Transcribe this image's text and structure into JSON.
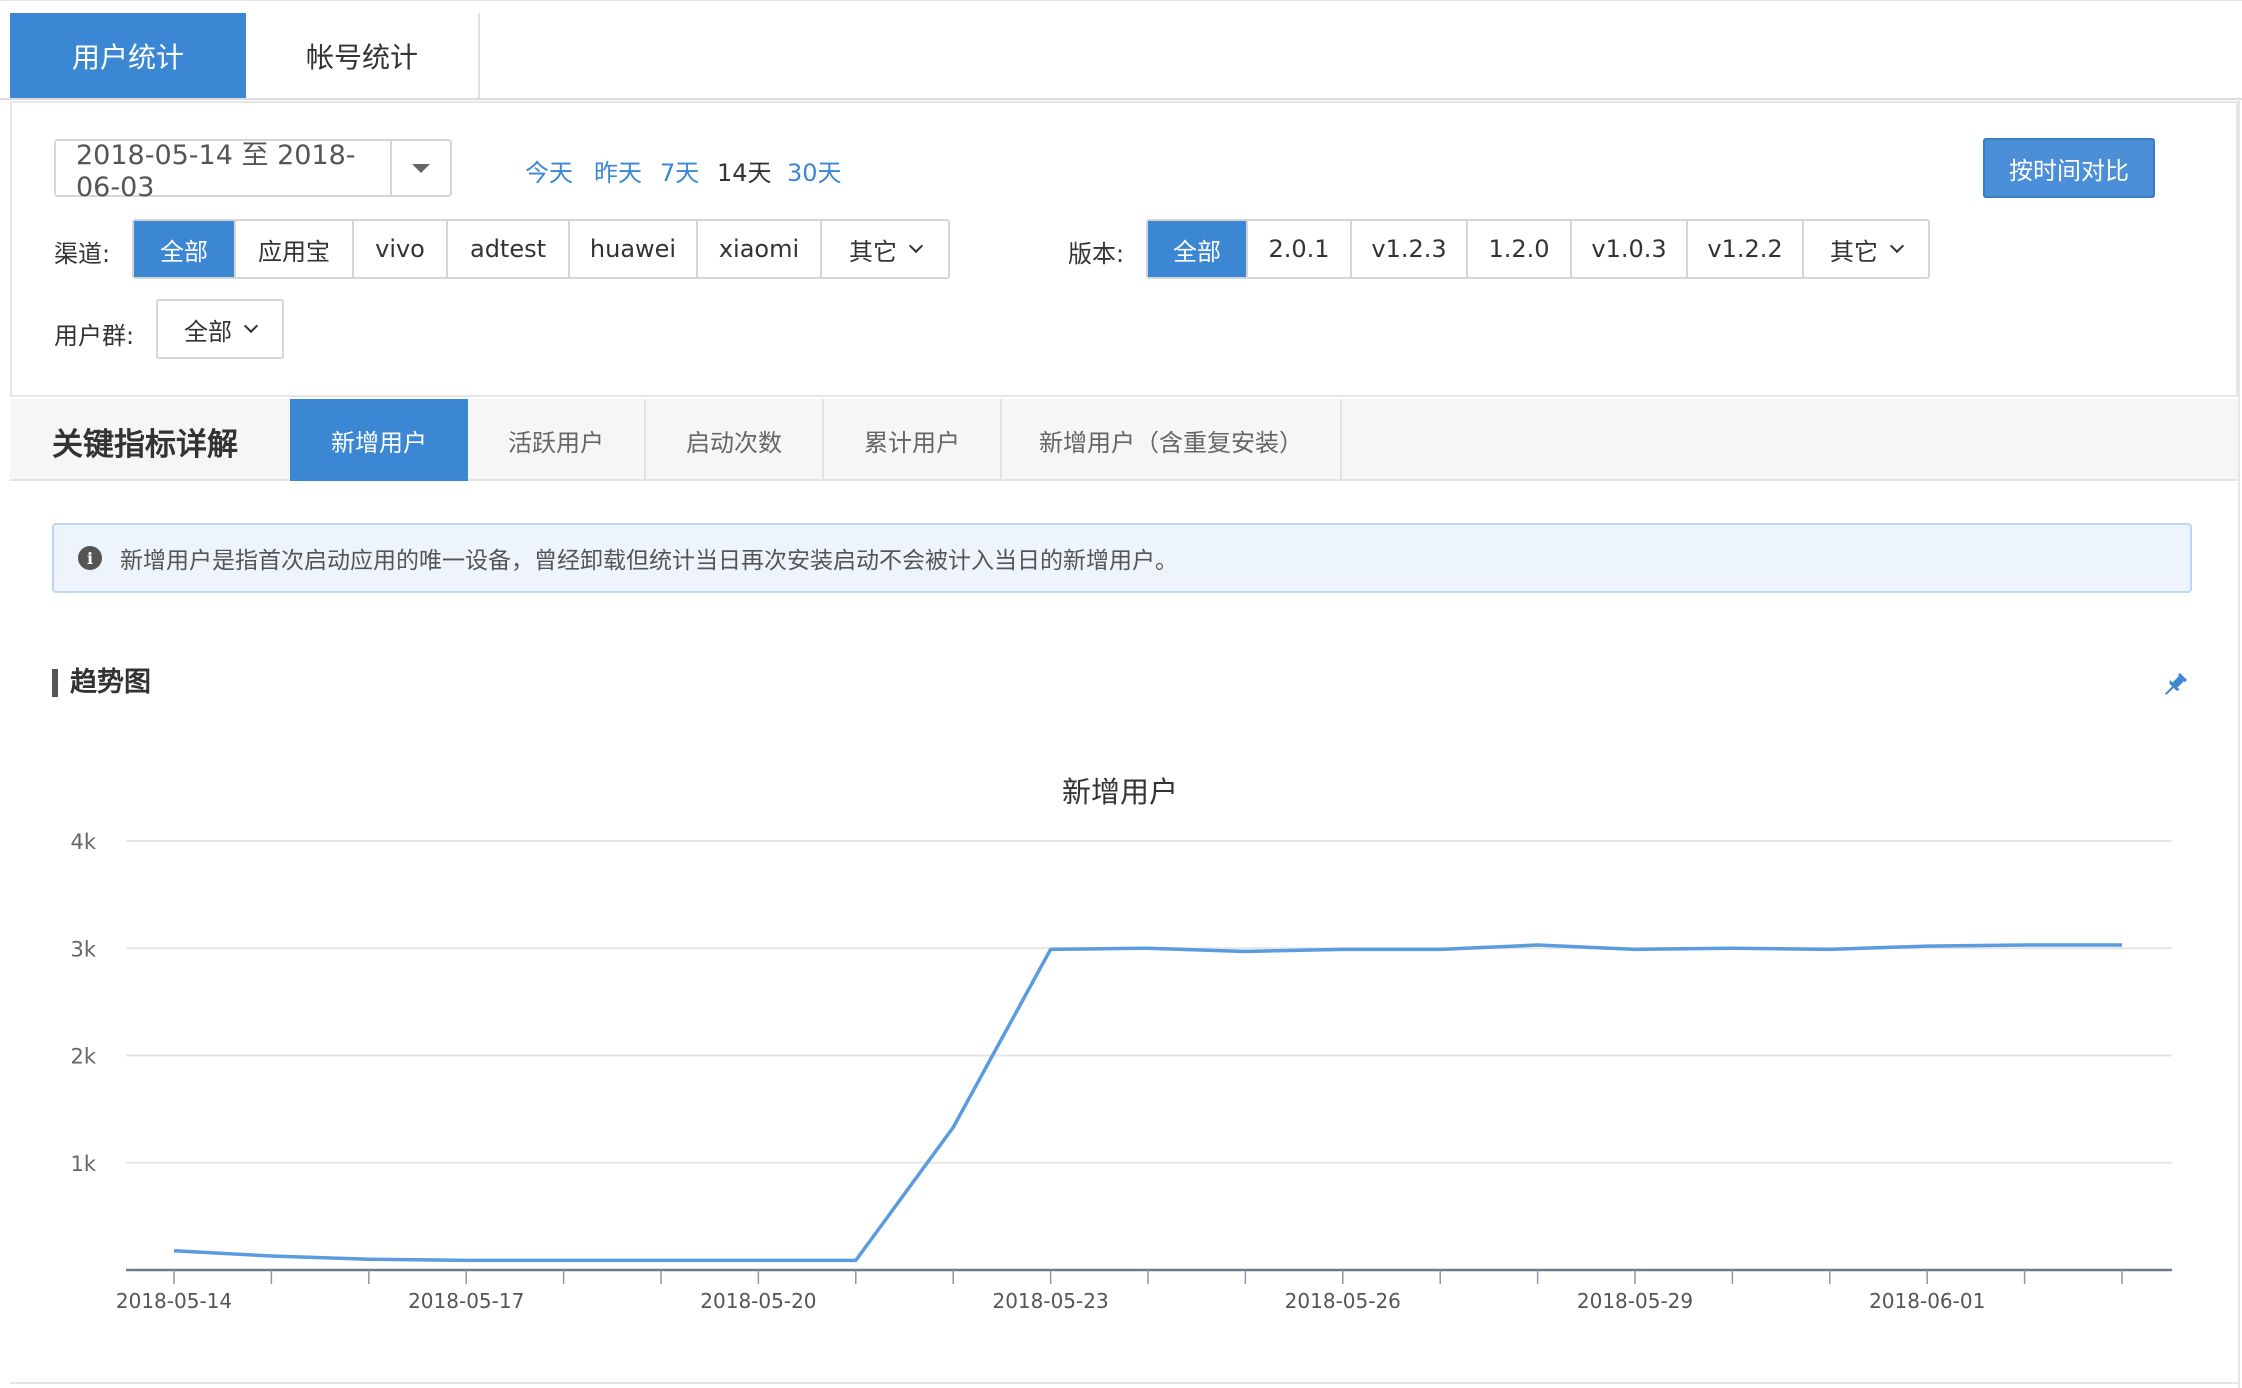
{
  "top_tabs": [
    {
      "label": "用户统计",
      "active": true
    },
    {
      "label": "帐号统计",
      "active": false
    }
  ],
  "filters": {
    "date_range": "2018-05-14 至 2018-06-03",
    "quick_ranges": [
      "今天",
      "昨天",
      "7天",
      "14天",
      "30天"
    ],
    "quick_active": "14天",
    "compare_button": "按时间对比",
    "channel_label": "渠道:",
    "channels": [
      "全部",
      "应用宝",
      "vivo",
      "adtest",
      "huawei",
      "xiaomi",
      "其它"
    ],
    "version_label": "版本:",
    "versions": [
      "全部",
      "2.0.1",
      "v1.2.3",
      "1.2.0",
      "v1.0.3",
      "v1.2.2",
      "其它"
    ],
    "user_group_label": "用户群:",
    "user_group_value": "全部"
  },
  "metrics": {
    "title": "关键指标详解",
    "tabs": [
      "新增用户",
      "活跃用户",
      "启动次数",
      "累计用户",
      "新增用户（含重复安装）"
    ],
    "active_tab": "新增用户"
  },
  "info": {
    "text": "新增用户是指首次启动应用的唯一设备，曾经卸载但统计当日再次安装启动不会被计入当日的新增用户。"
  },
  "section_title": "趋势图",
  "colors": {
    "accent": "#3b87d4",
    "line": "#5b9bdf"
  },
  "icons": {
    "info": "info-icon",
    "pin": "pin-icon",
    "date_dropdown": "caret-down-icon"
  },
  "chart_data": {
    "type": "line",
    "title": "新增用户",
    "x": [
      "2018-05-14",
      "2018-05-15",
      "2018-05-16",
      "2018-05-17",
      "2018-05-18",
      "2018-05-19",
      "2018-05-20",
      "2018-05-21",
      "2018-05-22",
      "2018-05-23",
      "2018-05-24",
      "2018-05-25",
      "2018-05-26",
      "2018-05-27",
      "2018-05-28",
      "2018-05-29",
      "2018-05-30",
      "2018-05-31",
      "2018-06-01",
      "2018-06-02",
      "2018-06-03"
    ],
    "x_tick_labels": [
      "2018-05-14",
      "2018-05-17",
      "2018-05-20",
      "2018-05-23",
      "2018-05-26",
      "2018-05-29",
      "2018-06-01"
    ],
    "y_tick_labels": [
      "1k",
      "2k",
      "3k",
      "4k"
    ],
    "y_ticks": [
      1000,
      2000,
      3000,
      4000
    ],
    "ylim": [
      0,
      4000
    ],
    "series": [
      {
        "values": [
          180,
          130,
          100,
          90,
          90,
          90,
          90,
          90,
          1330,
          2990,
          3000,
          2970,
          2990,
          2990,
          3030,
          2990,
          3000,
          2990,
          3020,
          3030,
          3030
        ]
      }
    ],
    "grid": true,
    "legend": "none"
  }
}
